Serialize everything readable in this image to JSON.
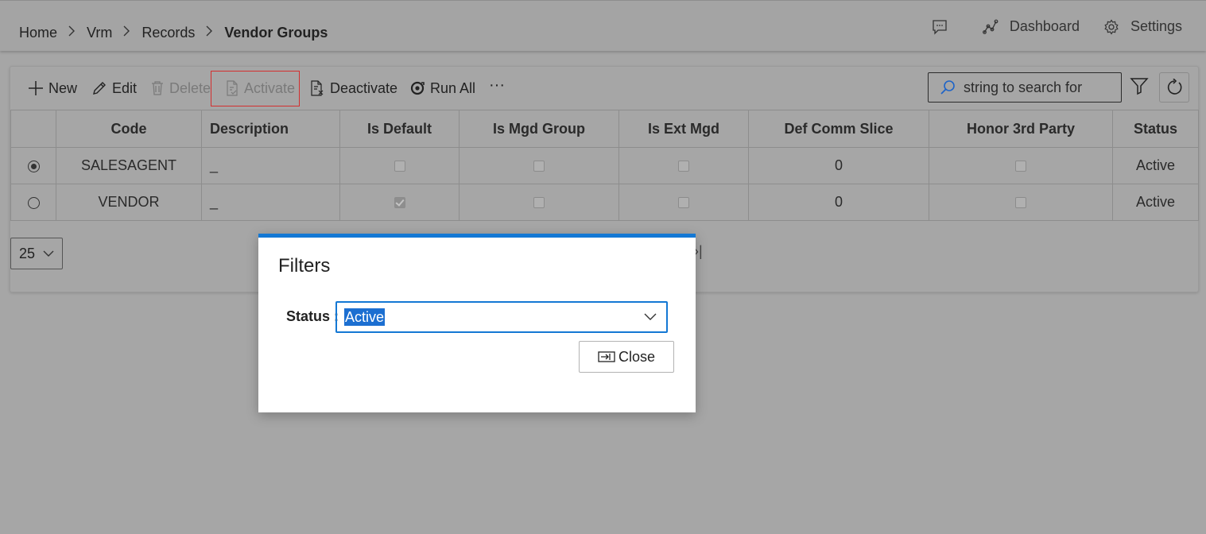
{
  "breadcrumb": {
    "items": [
      "Home",
      "Vrm",
      "Records"
    ],
    "current": "Vendor Groups"
  },
  "topnav": {
    "dashboard_label": "Dashboard",
    "settings_label": "Settings"
  },
  "toolbar": {
    "new_label": "New",
    "edit_label": "Edit",
    "delete_label": "Delete",
    "activate_label": "Activate",
    "deactivate_label": "Deactivate",
    "run_all_label": "Run All",
    "more_label": "···",
    "search_placeholder": "string to search for"
  },
  "table": {
    "columns": [
      "Code",
      "Description",
      "Is Default",
      "Is Mgd Group",
      "Is Ext Mgd",
      "Def Comm Slice",
      "Honor 3rd Party",
      "Status"
    ],
    "rows": [
      {
        "selected": true,
        "code": "SALESAGENT",
        "description": "_",
        "is_default": false,
        "is_mgd_group": false,
        "is_ext_mgd": false,
        "def_comm_slice": "0",
        "honor_3rd_party": false,
        "status": "Active"
      },
      {
        "selected": false,
        "code": "VENDOR",
        "description": "_",
        "is_default": true,
        "is_mgd_group": false,
        "is_ext_mgd": false,
        "def_comm_slice": "0",
        "honor_3rd_party": false,
        "status": "Active"
      }
    ]
  },
  "pager": {
    "page_size": "25",
    "last_symbol": "›|"
  },
  "dialog": {
    "title": "Filters",
    "status_label": "Status :",
    "status_value": "Active",
    "close_label": "Close"
  },
  "colors": {
    "accent": "#1478d4",
    "overlay_background": "#a6a6a6",
    "highlight_border": "#d32f2f"
  }
}
